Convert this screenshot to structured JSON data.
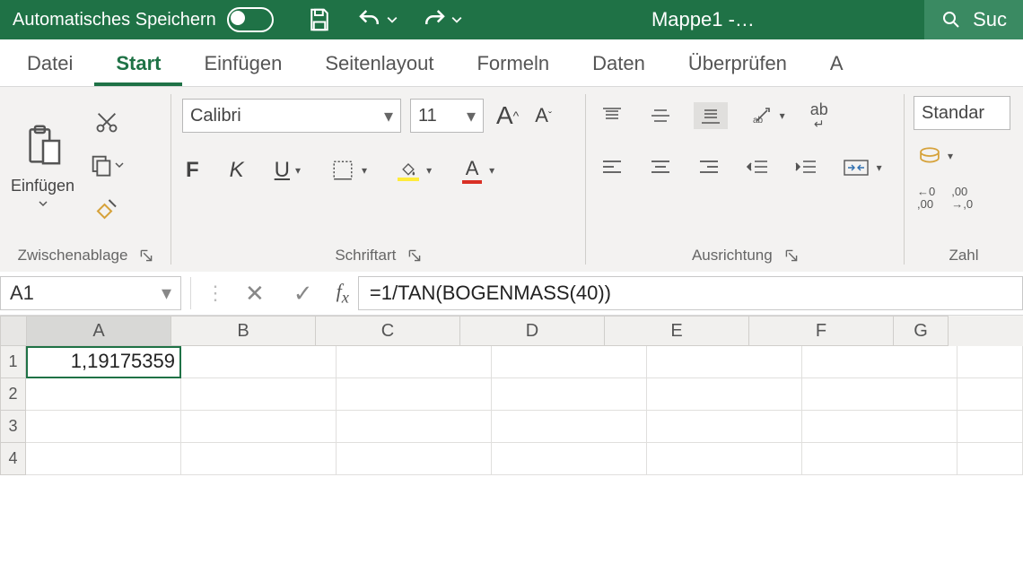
{
  "title": {
    "autosave_label": "Automatisches Speichern",
    "doc_name": "Mappe1  -…",
    "search_placeholder": "Suc"
  },
  "tabs": {
    "datei": "Datei",
    "start": "Start",
    "einfuegen": "Einfügen",
    "seitenlayout": "Seitenlayout",
    "formeln": "Formeln",
    "daten": "Daten",
    "ueberpruefen": "Überprüfen"
  },
  "clipboard": {
    "paste_label": "Einfügen",
    "group_label": "Zwischenablage"
  },
  "font": {
    "family": "Calibri",
    "size": "11",
    "bold": "F",
    "italic": "K",
    "underline": "U",
    "letter_big": "A",
    "group_label": "Schriftart"
  },
  "align": {
    "wrap": "ab",
    "group_label": "Ausrichtung"
  },
  "number": {
    "format": "Standar",
    "group_label": "Zahl",
    "dec1": "←0\n,00",
    "dec2": ",00\n→,0"
  },
  "namebox": {
    "ref": "A1"
  },
  "formula_bar": {
    "value": "=1/TAN(BOGENMASS(40))"
  },
  "columns": [
    "A",
    "B",
    "C",
    "D",
    "E",
    "F",
    "G"
  ],
  "rows": [
    "1",
    "2",
    "3",
    "4"
  ],
  "cells": {
    "A1": "1,19175359"
  }
}
